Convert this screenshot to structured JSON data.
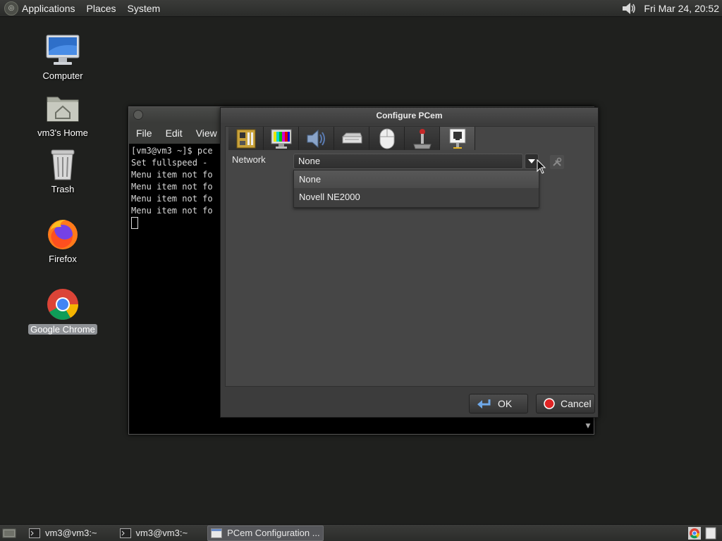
{
  "top_panel": {
    "menus": [
      "Applications",
      "Places",
      "System"
    ],
    "clock": "Fri Mar 24, 20:52"
  },
  "desktop_icons": [
    {
      "label": "Computer"
    },
    {
      "label": "vm3's Home"
    },
    {
      "label": "Trash"
    },
    {
      "label": "Firefox"
    },
    {
      "label": "Google Chrome"
    }
  ],
  "terminal": {
    "menus": [
      "File",
      "Edit",
      "View"
    ],
    "lines": [
      "[vm3@vm3 ~]$ pce",
      "Set fullspeed -",
      "Menu item not fo",
      "Menu item not fo",
      "Menu item not fo",
      "Menu item not fo"
    ]
  },
  "dialog": {
    "title": "Configure PCem",
    "network_label": "Network",
    "selected": "None",
    "options": [
      "None",
      "Novell NE2000"
    ],
    "ok_label": "OK",
    "cancel_label": "Cancel"
  },
  "taskbar": {
    "tasks": [
      "vm3@vm3:~",
      "vm3@vm3:~",
      "PCem Configuration ..."
    ]
  },
  "colors": {
    "desktop_bg": "#1f201e",
    "panel_bg": "#2b2c2a",
    "dialog_bg": "#3c3c3c"
  }
}
